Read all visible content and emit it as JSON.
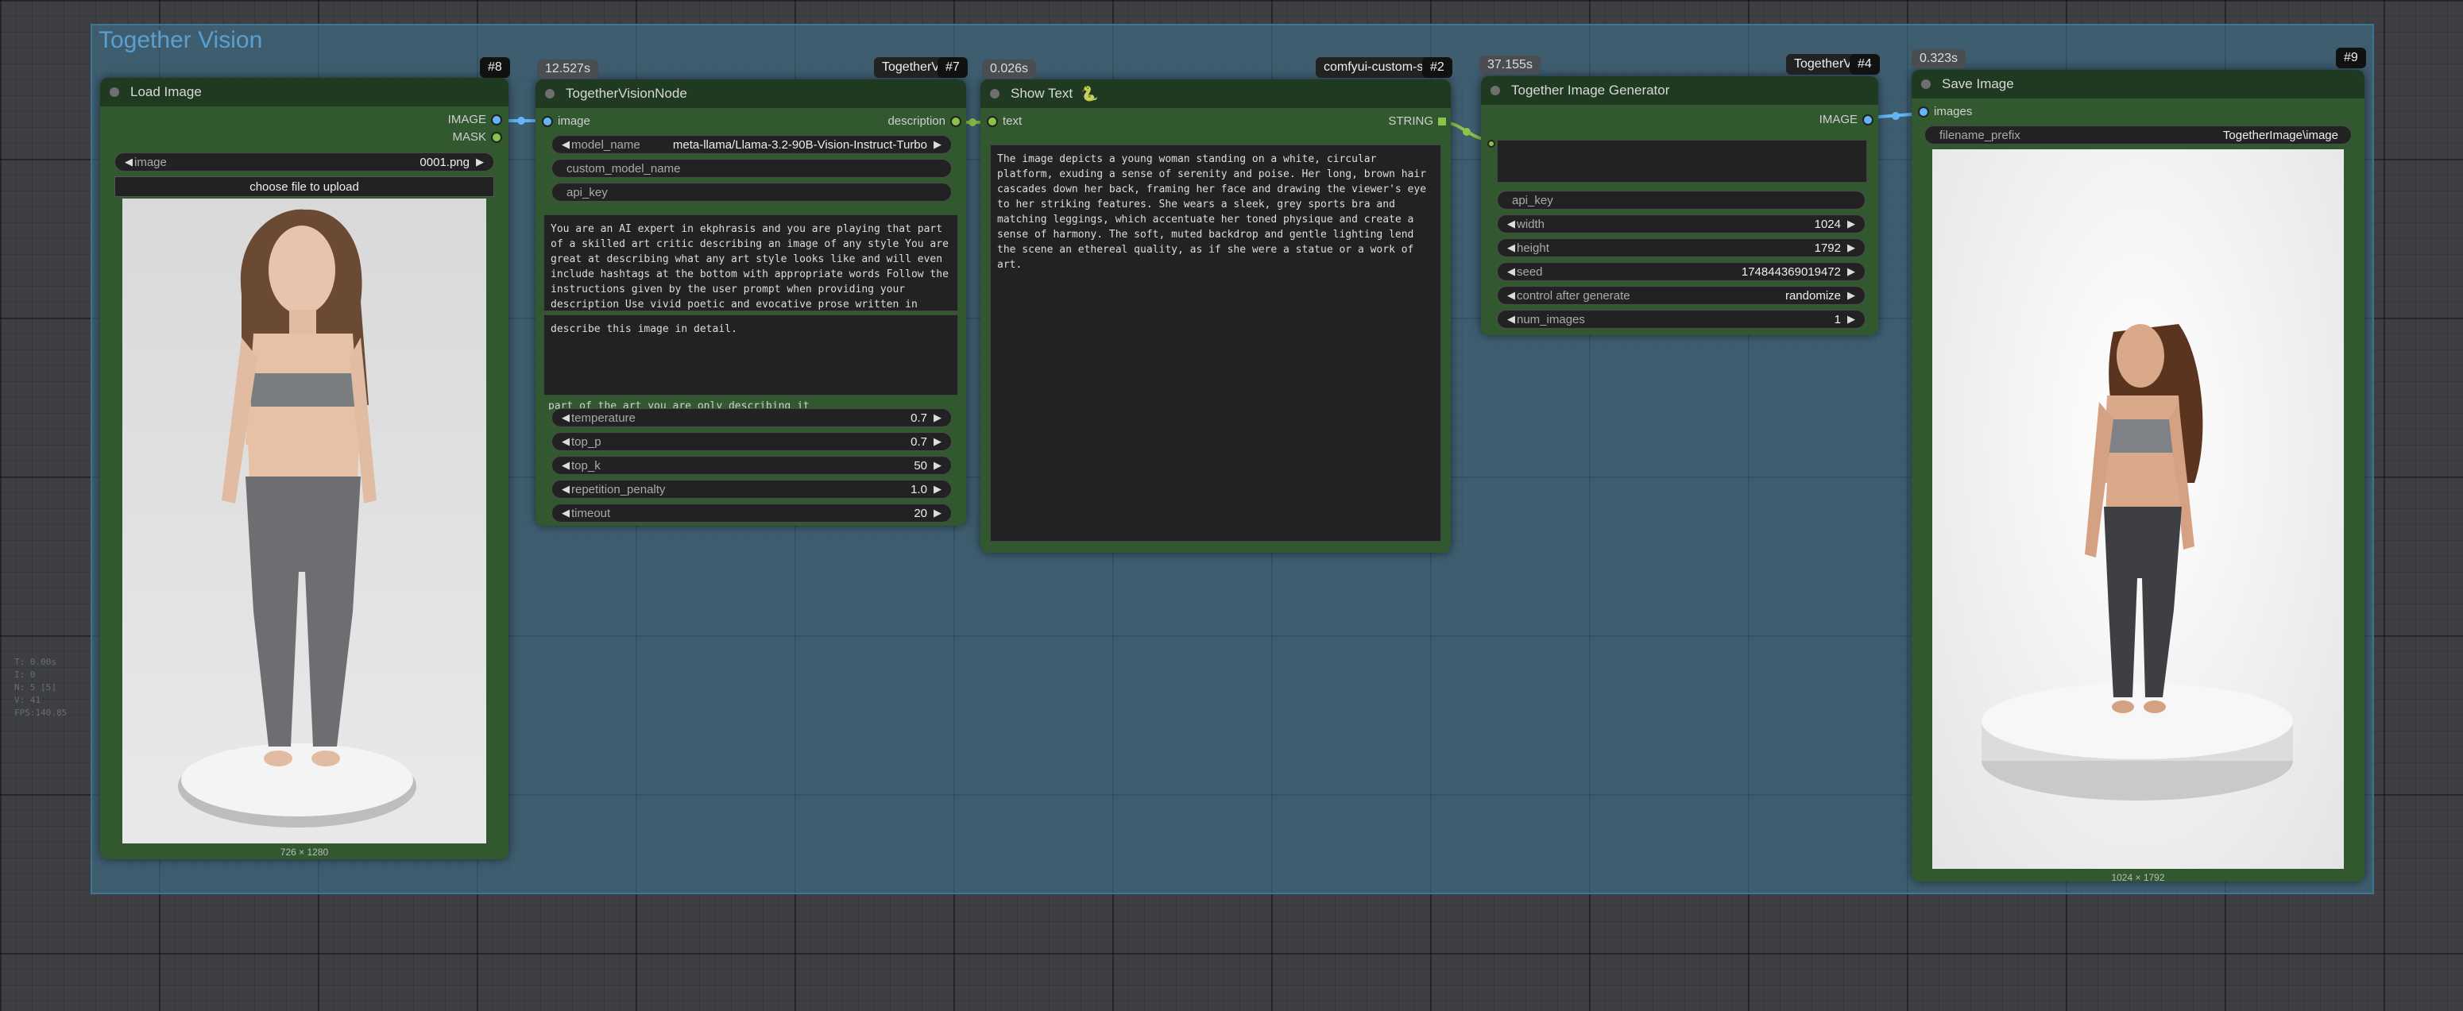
{
  "group": {
    "title": "Together Vision"
  },
  "stats": [
    "T: 0.00s",
    "I: 0",
    "N: 5 [5]",
    "V: 41",
    "FPS:140.85"
  ],
  "load_image": {
    "id": "#8",
    "title": "Load Image",
    "outputs": [
      "IMAGE",
      "MASK"
    ],
    "image_widget": {
      "label": "image",
      "value": "0001.png"
    },
    "upload_label": "choose file to upload",
    "caption": "726 × 1280"
  },
  "vision_node": {
    "id": "#7",
    "badge": "TogetherVi",
    "timer": "12.527s",
    "title": "TogetherVisionNode",
    "input": "image",
    "output": "description",
    "model_name": {
      "label": "model_name",
      "value": "meta-llama/Llama-3.2-90B-Vision-Instruct-Turbo"
    },
    "custom_model_name": "custom_model_name",
    "api_key": "api_key",
    "system_prompt": "You are an AI expert in ekphrasis and you are playing that part of a skilled art critic describing an image of any style You are great at describing what any art style looks like and will even include hashtags at the bottom with appropriate words Follow the instructions given by the user prompt when providing your description Use vivid poetic and evocative prose written in British English This is a story that you are telling so describe it as",
    "user_prompt": "describe this image in detail.",
    "overflow_line": "part of the art you are only describing it",
    "params": [
      {
        "label": "temperature",
        "value": "0.7"
      },
      {
        "label": "top_p",
        "value": "0.7"
      },
      {
        "label": "top_k",
        "value": "50"
      },
      {
        "label": "repetition_penalty",
        "value": "1.0"
      },
      {
        "label": "timeout",
        "value": "20"
      }
    ]
  },
  "show_text": {
    "id": "#2",
    "badge": "comfyui-custom-sc",
    "timer": "0.026s",
    "title": "Show Text",
    "input": "text",
    "output": "STRING",
    "text": "The image depicts a young woman standing on a white, circular platform, exuding a sense of serenity and poise. Her long, brown hair cascades down her back, framing her face and drawing the viewer's eye to her striking features. She wears a sleek, grey sports bra and matching leggings, which accentuate her toned physique and create a sense of harmony. The soft, muted backdrop and gentle lighting lend the scene an ethereal quality, as if she were a statue or a work of art."
  },
  "generator": {
    "id": "#4",
    "badge": "TogetherVi",
    "timer": "37.155s",
    "title": "Together Image Generator",
    "output": "IMAGE",
    "api_key": "api_key",
    "widgets": [
      {
        "label": "width",
        "value": "1024"
      },
      {
        "label": "height",
        "value": "1792"
      },
      {
        "label": "seed",
        "value": "174844369019472"
      },
      {
        "label": "control after generate",
        "value": "randomize"
      },
      {
        "label": "num_images",
        "value": "1"
      }
    ]
  },
  "save_image": {
    "id": "#9",
    "timer": "0.323s",
    "title": "Save Image",
    "input": "images",
    "filename_prefix": {
      "label": "filename_prefix",
      "value": "TogetherImage\\image"
    },
    "caption": "1024 × 1792"
  },
  "colors": {
    "node_body": "#32582f",
    "node_header": "#1f3a21",
    "image_link": "#64b5f6",
    "string_link": "#8bc34a",
    "group": "#3f7896"
  }
}
